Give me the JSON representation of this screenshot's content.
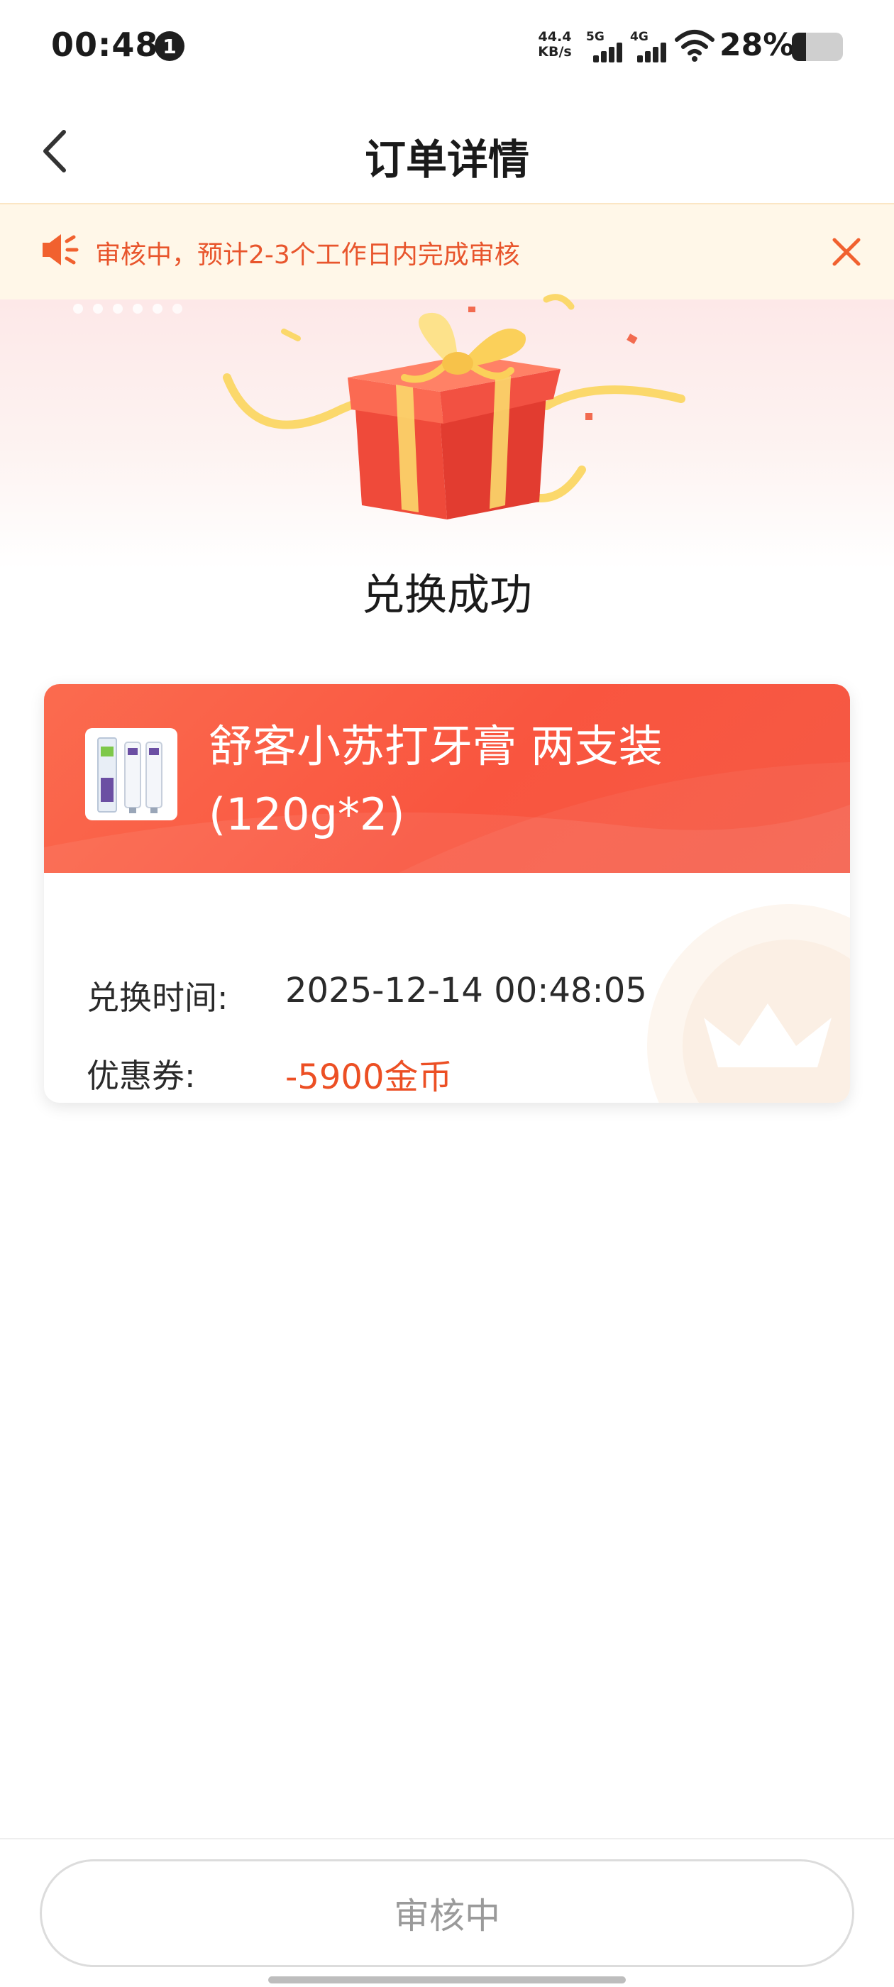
{
  "status_bar": {
    "time": "00:48",
    "notification_count": "1",
    "net_speed_value": "44.4",
    "net_speed_unit": "KB/s",
    "signal_1_label": "5G",
    "signal_2_label": "4G",
    "battery_percent_text": "28%",
    "battery_level": 0.28
  },
  "header": {
    "title": "订单详情"
  },
  "notice": {
    "text": "审核中，预计2-3个工作日内完成审核",
    "speaker_icon": "speaker-icon",
    "close_icon": "close-icon"
  },
  "hero": {
    "status_text": "兑换成功",
    "illustration": "gift-box-icon"
  },
  "order": {
    "product_name": "舒客小苏打牙膏  两支装(120g*2)",
    "product_image": "toothpaste-thumbnail",
    "fields": [
      {
        "label": "兑换时间:",
        "value": "2025-12-14 00:48:05"
      },
      {
        "label": "优惠券:",
        "value": "-5900金币"
      }
    ]
  },
  "footer": {
    "button_label": "审核中"
  },
  "colors": {
    "accent": "#f9553f",
    "coin_text": "#ec4f24",
    "notice_text": "#e8552c",
    "notice_bg": "#fff7e8"
  }
}
